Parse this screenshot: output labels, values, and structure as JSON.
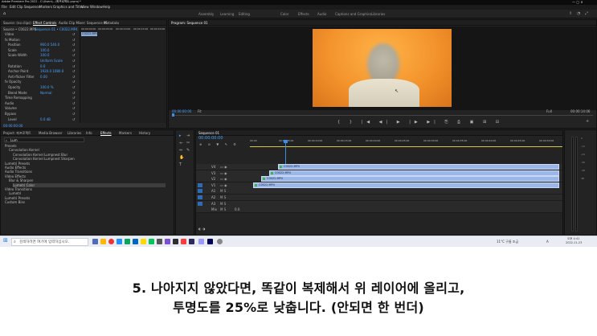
{
  "app": {
    "title": "Adobe Premiere Pro 2022 - C:\\Users\\...\\퐈프로젝트.prproj *"
  },
  "menu": [
    "File",
    "Edit",
    "Clip",
    "Sequence",
    "Markers",
    "Graphics and Titles",
    "View",
    "Window",
    "Help"
  ],
  "workspaces": [
    "Assembly",
    "Learning",
    "Editing",
    "Color",
    "Effects",
    "Audio",
    "Captions and Graphics",
    "Libraries"
  ],
  "source_panel": {
    "tabs": [
      "Source: (no clips)",
      "Effect Controls",
      "Audio Clip Mixer: Sequence 01",
      "Metadata"
    ],
    "source_label": "Source • C0022.MP4",
    "sequence_label": "Sequence 01 • C0022.MP4",
    "timecodes": [
      "00:00:00:00",
      "00:00:05:00",
      "00:00:10:00",
      "00:00:15:00",
      "00:00:20:00"
    ],
    "clip_chip": "C0022.MP4",
    "rows": [
      {
        "label": "Video",
        "value": ""
      },
      {
        "label": "fx Motion",
        "value": ""
      },
      {
        "label": "Position",
        "value": "960.0   540.0"
      },
      {
        "label": "Scale",
        "value": "100.0"
      },
      {
        "label": "Scale Width",
        "value": "100.0"
      },
      {
        "label": "",
        "value": "Uniform Scale"
      },
      {
        "label": "Rotation",
        "value": "0.0"
      },
      {
        "label": "Anchor Point",
        "value": "1920.0   1080.0"
      },
      {
        "label": "Anti-flicker Filter",
        "value": "0.00"
      },
      {
        "label": "fx Opacity",
        "value": ""
      },
      {
        "label": "Opacity",
        "value": "100.0 %"
      },
      {
        "label": "Blend Mode",
        "value": "Normal"
      },
      {
        "label": "Time Remapping",
        "value": ""
      },
      {
        "label": "Audio",
        "value": ""
      },
      {
        "label": "Volume",
        "value": ""
      },
      {
        "label": "Bypass",
        "value": ""
      },
      {
        "label": "Level",
        "value": "0.0 dB"
      }
    ],
    "timecode": "00:00:00:00"
  },
  "program_panel": {
    "title": "Program: Sequence 01",
    "timecode_left": "00:00:00:00",
    "fit": "Fit",
    "quality": "Full",
    "timecode_right": "00:00:14:06"
  },
  "project_panel": {
    "tabs": [
      "Project: 퐈프로젝트",
      "Media Browser",
      "Libraries",
      "Info",
      "Effects",
      "Markers",
      "History"
    ],
    "search": "Lum",
    "tree": [
      "Presets",
      "Convolution Kernel",
      "Convolution Kernel Lumpnest Blur",
      "Convolution Kernel Lumpnest Sharpen",
      "Lumetri Presets",
      "Audio Effects",
      "Audio Transitions",
      "Video Effects",
      "Blur & Sharpen",
      "Lumetri Color",
      "Video Transitions",
      "Lumetri",
      "Lumetri Presets",
      "Custom Bins"
    ]
  },
  "timeline": {
    "tab": "Sequence 01",
    "timecode": "00:00:00:00",
    "ruler": [
      "00:00",
      "00:00:05:00",
      "00:00:10:00",
      "00:00:15:00",
      "00:00:20:00",
      "00:00:25:00",
      "00:00:30:00",
      "00:00:35:00",
      "00:00:40:00",
      "00:00:45:00",
      "00:00:50:00"
    ],
    "tracks": [
      "V4",
      "V3",
      "V2",
      "V1",
      "A1",
      "A2",
      "A3",
      "Mix"
    ],
    "clips": [
      {
        "track": "V4",
        "label": "C0022.MP4"
      },
      {
        "track": "V3",
        "label": "C0022.MP4"
      },
      {
        "track": "V2",
        "label": "C0022.MP4"
      },
      {
        "track": "V1",
        "label": "C0022.MP4"
      }
    ],
    "mix_value": "0.0"
  },
  "taskbar": {
    "search_placeholder": "검색하려면 여기에 입력하십시오.",
    "weather": "11°C 구름 조금",
    "lang": "A",
    "time": "오후 4:41",
    "date": "2022-11-23"
  },
  "caption": {
    "line1": "5. 나아지지 않았다면, 똑같이 복제해서 위 레이어에 올리고,",
    "line2": "투명도를 25%로 낮춥니다. (안되면 한 번더)"
  },
  "colors": {
    "accent": "#4aa3ff",
    "clip": "#9bb7e8",
    "playhead": "#3a8ee6"
  }
}
